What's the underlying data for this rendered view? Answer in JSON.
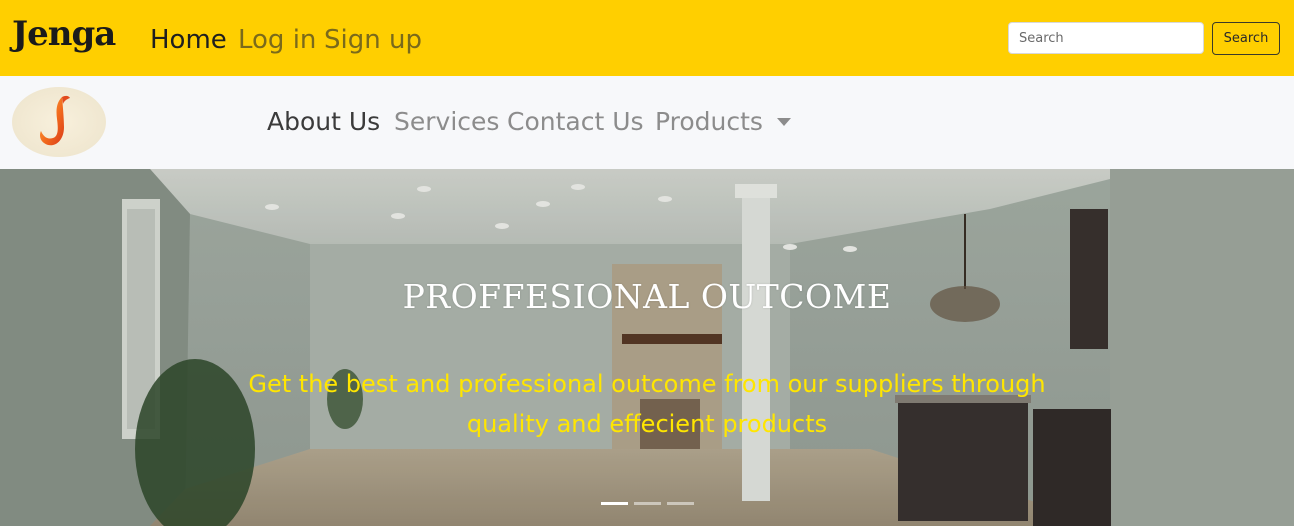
{
  "topnav": {
    "brand": "Jenga",
    "links": [
      "Home",
      "Log in",
      "Sign up"
    ],
    "search_placeholder": "Search",
    "search_button": "Search",
    "bg_color": "#ffcf00"
  },
  "subnav": {
    "logo_letter": "J",
    "links": [
      "About Us",
      "Services",
      "Contact Us",
      "Products"
    ]
  },
  "hero": {
    "title": "PROFFESIONAL OUTCOME",
    "subtitle_line1": "Get the best and professional outcome from our suppliers through",
    "subtitle_line2": "quality and effecient products",
    "subtitle_color": "#ffe600",
    "slide_count": 3,
    "active_slide": 1
  }
}
